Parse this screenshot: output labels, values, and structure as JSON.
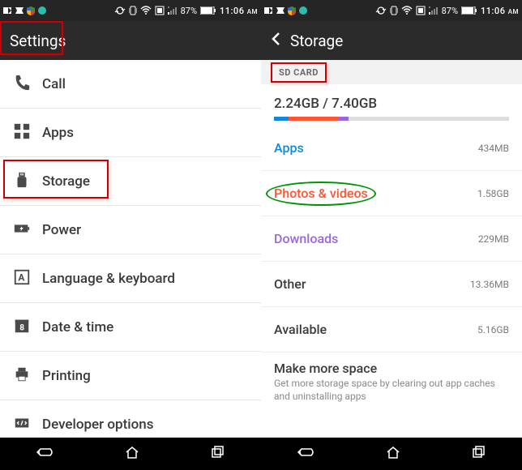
{
  "status": {
    "battery": "87%",
    "time": "11:06",
    "ampm": "AM"
  },
  "left": {
    "title": "Settings",
    "items": [
      {
        "label": "Call",
        "icon": "phone"
      },
      {
        "label": "Apps",
        "icon": "apps"
      },
      {
        "label": "Storage",
        "icon": "usb"
      },
      {
        "label": "Power",
        "icon": "power"
      },
      {
        "label": "Language & keyboard",
        "icon": "lang"
      },
      {
        "label": "Date & time",
        "icon": "date"
      },
      {
        "label": "Printing",
        "icon": "print"
      },
      {
        "label": "Developer options",
        "icon": "dev"
      }
    ]
  },
  "right": {
    "title": "Storage",
    "section": "SD CARD",
    "usage": "2.24GB / 7.40GB",
    "rows": [
      {
        "label": "Apps",
        "value": "434MB",
        "color": "c-blue"
      },
      {
        "label": "Photos & videos",
        "value": "1.58GB",
        "color": "c-orange",
        "oval": true
      },
      {
        "label": "Downloads",
        "value": "229MB",
        "color": "c-purple"
      },
      {
        "label": "Other",
        "value": "13.36MB",
        "color": "c-gray"
      },
      {
        "label": "Available",
        "value": "5.16GB",
        "color": "c-gray"
      }
    ],
    "more": {
      "title": "Make more space",
      "desc": "Get more storage space by clearing out app caches and uninstalling apps"
    }
  },
  "nav": [
    "back",
    "home",
    "recent"
  ]
}
